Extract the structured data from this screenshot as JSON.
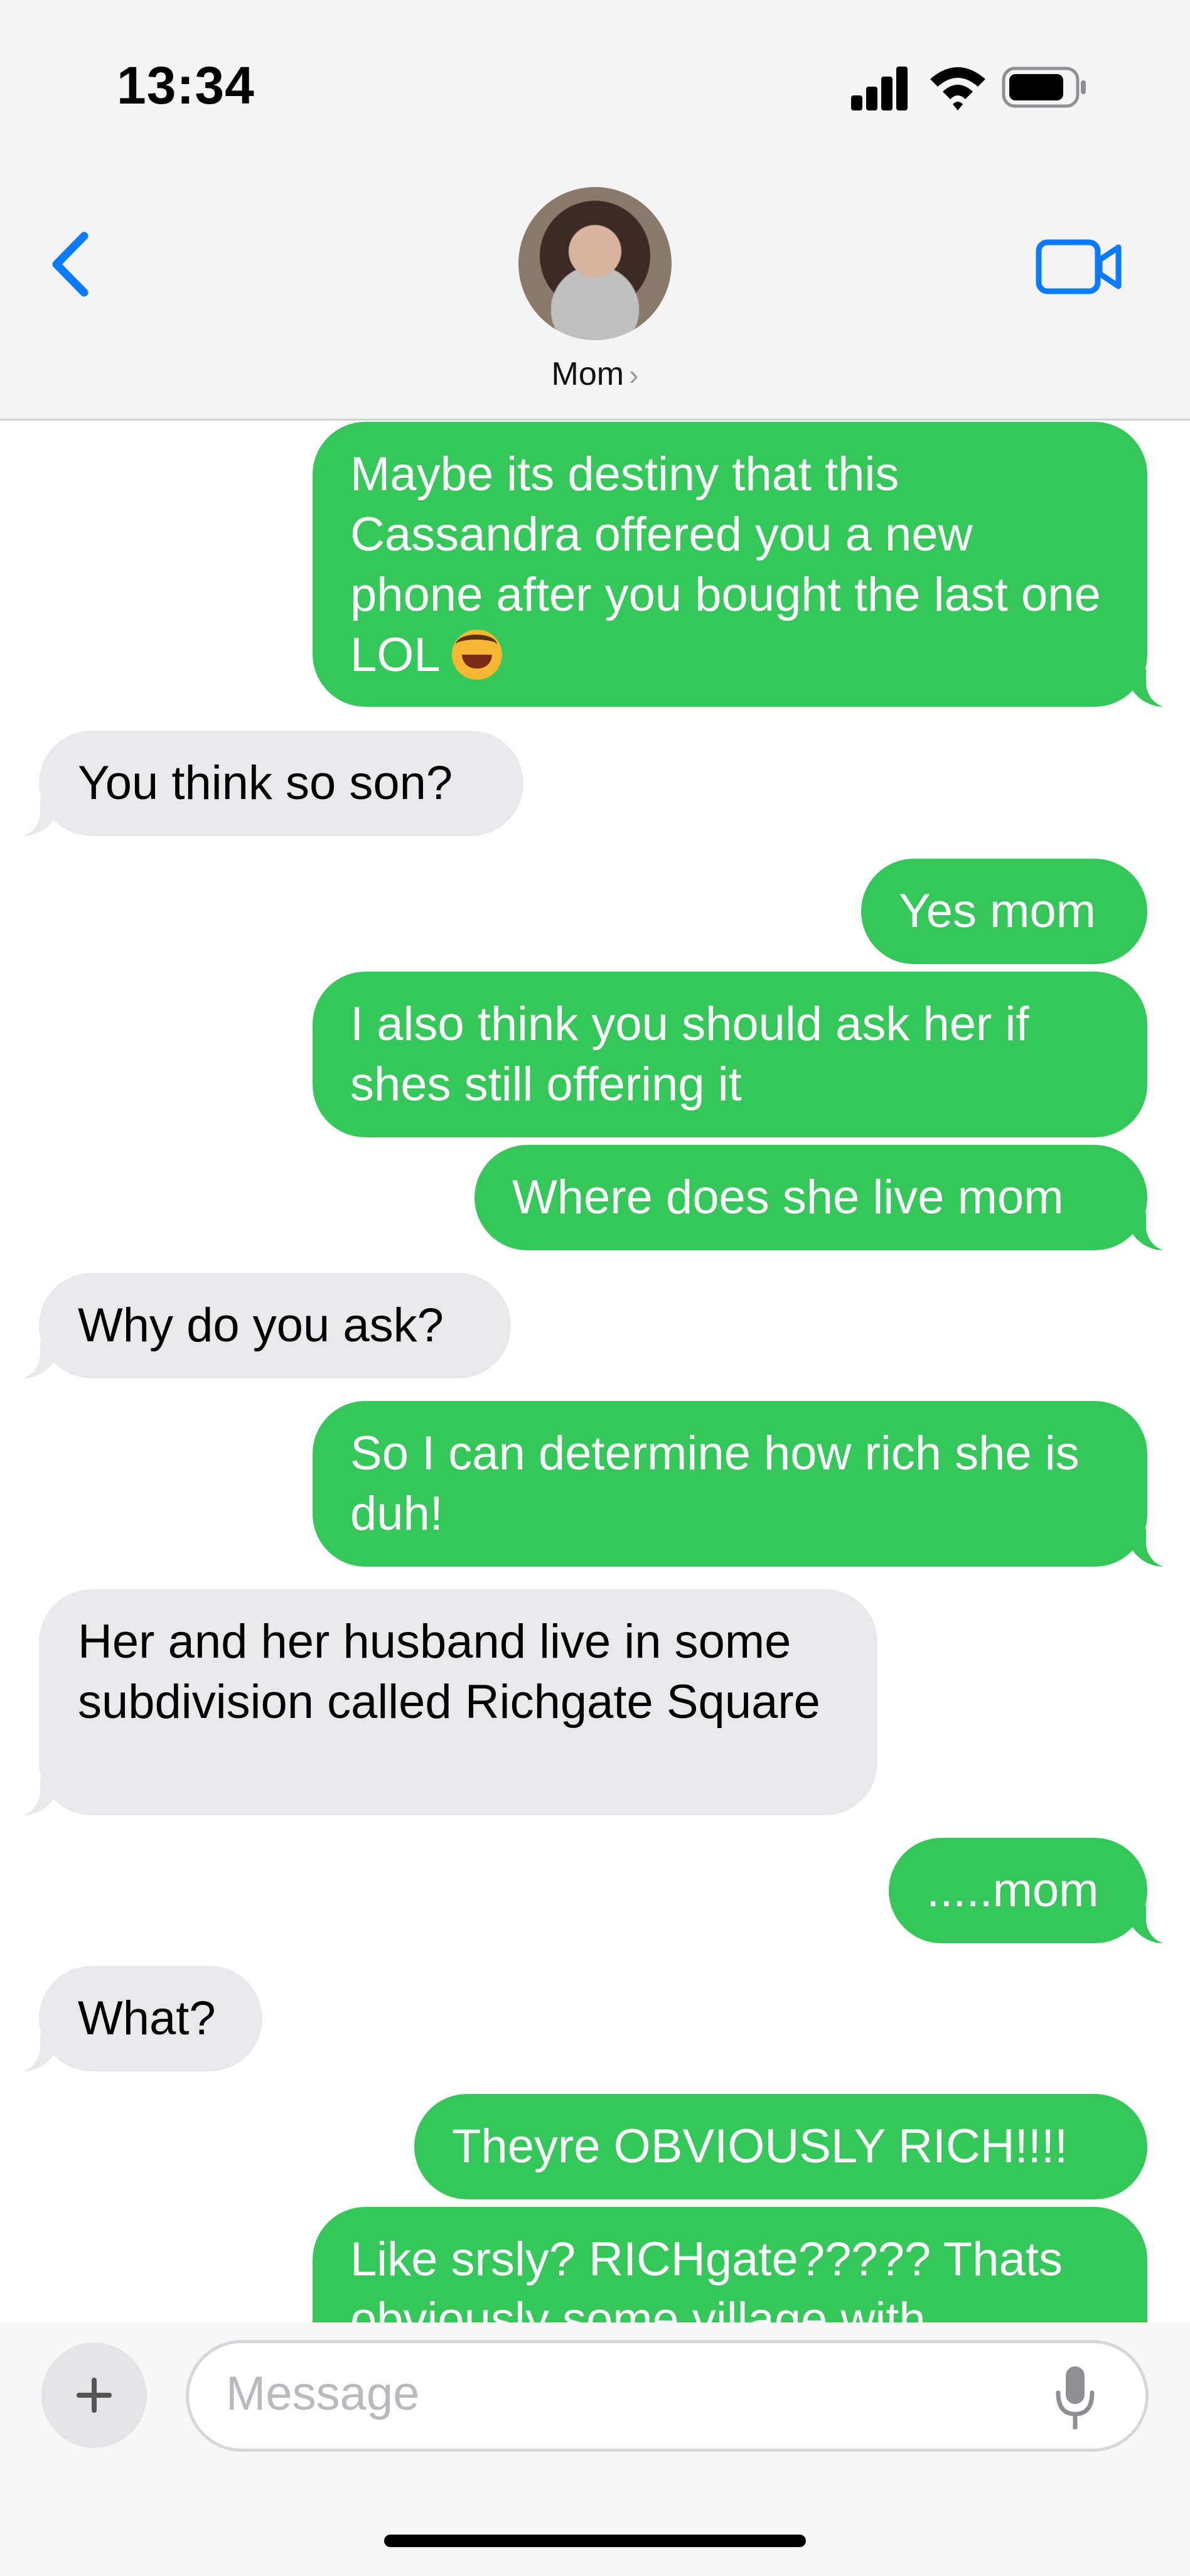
{
  "status": {
    "time": "13:34"
  },
  "header": {
    "contact_name": "Mom"
  },
  "colors": {
    "outgoing": "#35c75a",
    "incoming": "#e9e9eb",
    "accent": "#0a7aff"
  },
  "messages": [
    {
      "dir": "out",
      "text": "Maybe its destiny that this Cassandra offered you a new phone after you bought the last one LOL",
      "emoji": "rolling-on-floor-laughing"
    },
    {
      "dir": "in",
      "text": "You think so son?"
    },
    {
      "dir": "out",
      "text": "Yes mom"
    },
    {
      "dir": "out",
      "text": "I also think you should ask her if shes still offering it"
    },
    {
      "dir": "out",
      "text": "Where does she live mom"
    },
    {
      "dir": "in",
      "text": "Why do you ask?"
    },
    {
      "dir": "out",
      "text": "So I can determine how rich she is duh!"
    },
    {
      "dir": "in",
      "text": "Her and her husband live in some subdivision called Richgate Square"
    },
    {
      "dir": "out",
      "text": ".....mom"
    },
    {
      "dir": "in",
      "text": "What?"
    },
    {
      "dir": "out",
      "text": "Theyre OBVIOUSLY RICH!!!!"
    },
    {
      "dir": "out",
      "text": "Like srsly? RICHgate????? Thats obviously some village with"
    }
  ],
  "composer": {
    "placeholder": "Message"
  }
}
